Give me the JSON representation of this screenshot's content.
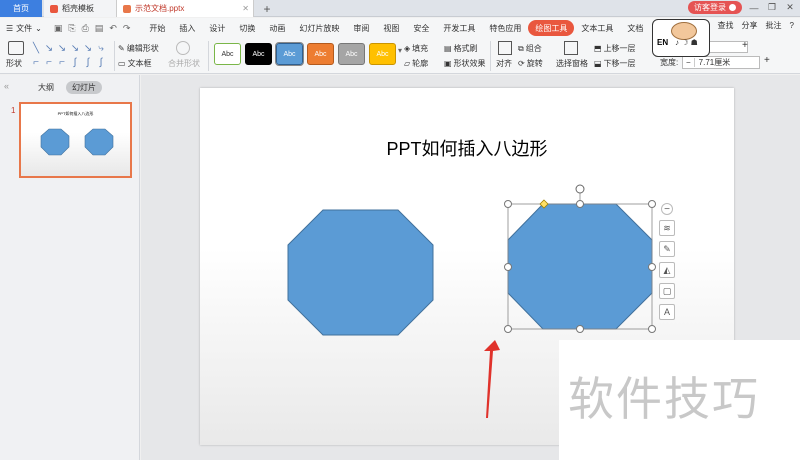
{
  "tabs": {
    "home": "首页",
    "template": "稻壳模板",
    "document": "示范文档.pptx",
    "add": "+"
  },
  "window": {
    "visitor": "访客登录",
    "minimize": "—",
    "restore": "❐",
    "close": "✕"
  },
  "menu": {
    "file": "文件",
    "items": [
      "开始",
      "插入",
      "设计",
      "切换",
      "动画",
      "幻灯片放映",
      "审阅",
      "视图",
      "安全",
      "开发工具",
      "特色应用",
      "绘图工具",
      "文本工具",
      "文档"
    ],
    "active_index": 11,
    "share": "分享",
    "comment": "批注",
    "find": "查找"
  },
  "ribbon": {
    "shape": "形状",
    "edit_shape": "编辑形状",
    "text_box": "文本框",
    "merge_shape": "合并形状",
    "style_label": "Abc",
    "styles": [
      {
        "bg": "#ffffff",
        "fg": "#333333",
        "border": "#7ab648"
      },
      {
        "bg": "#000000",
        "fg": "#ffffff",
        "border": "#000000"
      },
      {
        "bg": "#5b9bd5",
        "fg": "#ffffff",
        "border": "#2f5f8f"
      },
      {
        "bg": "#ed7d31",
        "fg": "#ffffff",
        "border": "#b35a1d"
      },
      {
        "bg": "#a5a5a5",
        "fg": "#ffffff",
        "border": "#777777"
      },
      {
        "bg": "#ffc000",
        "fg": "#ffffff",
        "border": "#c99400"
      }
    ],
    "fill": "填充",
    "format_painter": "格式刷",
    "outline": "轮廓",
    "shape_effects": "形状效果",
    "align": "对齐",
    "group": "组合",
    "rotate": "旋转",
    "selection_pane": "选择窗格",
    "bring_forward": "上移一层",
    "send_backward": "下移一层",
    "width_label": "宽度:",
    "width_value": "7.71厘米",
    "height_value": ""
  },
  "badge": {
    "text": "EN"
  },
  "left_panel": {
    "outline_tab": "大纲",
    "slides_tab": "幻灯片",
    "slide_number": "1",
    "thumb_title": "PPT如何插入八边形"
  },
  "slide": {
    "title": "PPT如何插入八边形"
  },
  "watermark": "软件技巧",
  "colors": {
    "octagon_fill": "#5b9bd5",
    "octagon_stroke": "#41719c",
    "accent": "#e9573e",
    "arrow": "#e0322b"
  }
}
